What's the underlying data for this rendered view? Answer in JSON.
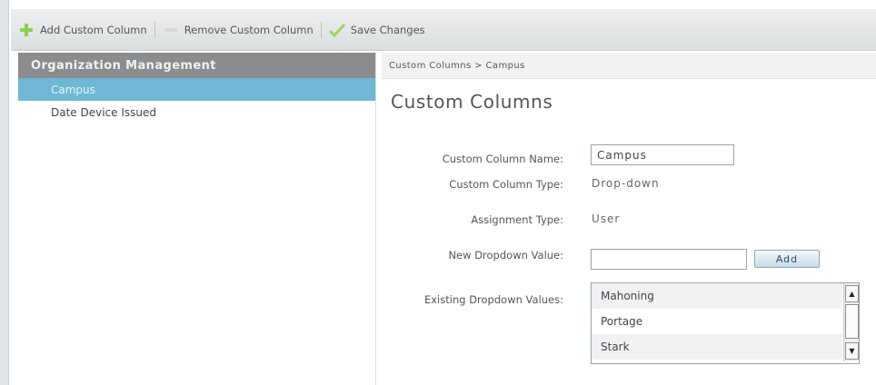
{
  "toolbar": {
    "add_label": "Add Custom Column",
    "remove_label": "Remove Custom Column",
    "save_label": "Save Changes"
  },
  "sidebar": {
    "header": "Organization Management",
    "items": [
      {
        "label": "Campus",
        "selected": true
      },
      {
        "label": "Date Device Issued",
        "selected": false
      }
    ]
  },
  "main": {
    "breadcrumb": "Custom Columns > Campus",
    "title": "Custom Columns",
    "form": {
      "name_label": "Custom Column Name:",
      "name_value": "Campus",
      "type_label": "Custom Column Type:",
      "type_value": "Drop-down",
      "assign_label": "Assignment Type:",
      "assign_value": "User",
      "new_value_label": "New Dropdown Value:",
      "new_value": "",
      "add_button": "Add",
      "existing_label": "Existing Dropdown Values:",
      "existing_values": [
        "Mahoning",
        "Portage",
        "Stark"
      ]
    }
  },
  "colors": {
    "selected_item": "#6eb8d6",
    "sidebar_header": "#8a8c8e",
    "add_icon": "#8fcf5a",
    "save_icon": "#9bd35f"
  },
  "icons": {
    "add": "plus-icon",
    "remove": "minus-icon",
    "save": "checkmark-icon"
  }
}
